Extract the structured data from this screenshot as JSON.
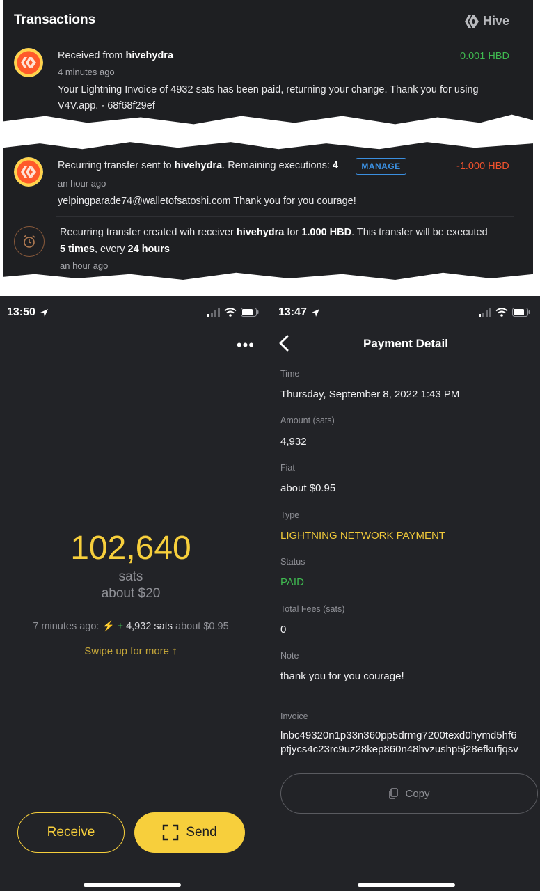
{
  "hive": {
    "title": "Transactions",
    "brand": "Hive",
    "tx1": {
      "prefix": "Received from ",
      "user": "hivehydra",
      "time": "4 minutes ago",
      "amount": "0.001 HBD",
      "memo_line1": "Your Lightning Invoice of 4932 sats has been paid, returning your change. Thank you for using",
      "memo_line2": "V4V.app. - 68f68f29ef"
    },
    "tx2": {
      "prefix": "Recurring transfer sent to ",
      "user": "hivehydra",
      "middle": ". Remaining executions: ",
      "executions": "4",
      "manage": "MANAGE",
      "amount": "-1.000 HBD",
      "time": "an hour ago",
      "memo": "yelpingparade74@walletofsatoshi.com Thank you for you courage!"
    },
    "tx3": {
      "prefix": "Recurring transfer created wih receiver ",
      "user": "hivehydra",
      "mid": " for ",
      "amount": "1.000 HBD",
      "suffix": ". This transfer will be executed",
      "times": "5 times",
      "every": ", every ",
      "interval": "24 hours",
      "time": "an hour ago"
    }
  },
  "wallet": {
    "status_time": "13:50",
    "balance": "102,640",
    "unit": "sats",
    "fiat": "about $20",
    "recent_time": "7 minutes ago:",
    "recent_plus": "+",
    "recent_amount": "4,932 sats",
    "recent_fiat": "about $0.95",
    "swipe": "Swipe up for more",
    "receive": "Receive",
    "send": "Send"
  },
  "detail": {
    "status_time": "13:47",
    "title": "Payment Detail",
    "time_label": "Time",
    "time_value": "Thursday, September 8, 2022 1:43 PM",
    "amount_label": "Amount (sats)",
    "amount_value": "4,932",
    "fiat_label": "Fiat",
    "fiat_value": "about $0.95",
    "type_label": "Type",
    "type_value": "LIGHTNING NETWORK PAYMENT",
    "status_label": "Status",
    "status_value": "PAID",
    "fees_label": "Total Fees (sats)",
    "fees_value": "0",
    "note_label": "Note",
    "note_value": "thank you for you courage!",
    "invoice_label": "Invoice",
    "invoice_line1": "lnbc49320n1p33n360pp5drmg7200texd0hymd5hf6",
    "invoice_line2": "ptjycs4c23rc9uz28kep860n48hvzushp5j28efkufjqsv",
    "copy": "Copy"
  },
  "colors": {
    "accent_yellow": "#f7cf3c",
    "positive_green": "#3fb950",
    "negative_red": "#f0522d",
    "manage_blue": "#3b8fe0"
  }
}
